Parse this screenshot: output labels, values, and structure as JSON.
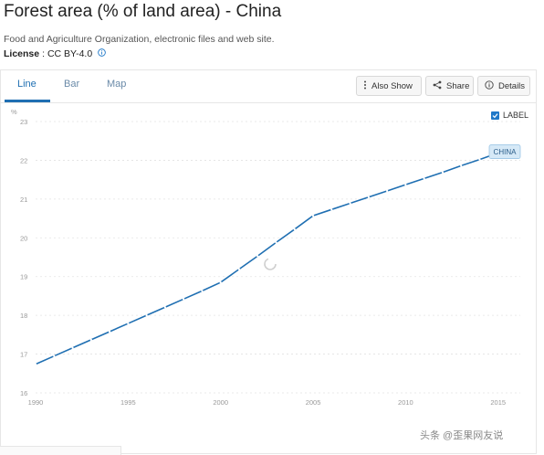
{
  "header": {
    "title": "Forest area (% of land area) - China",
    "source": "Food and Agriculture Organization, electronic files and web site.",
    "license_label": "License",
    "license_value": ": CC BY-4.0"
  },
  "tabs": [
    {
      "label": "Line",
      "active": true
    },
    {
      "label": "Bar",
      "active": false
    },
    {
      "label": "Map",
      "active": false
    }
  ],
  "toolbar": {
    "also_show": "Also Show",
    "share": "Share",
    "details": "Details"
  },
  "label_toggle": {
    "label": "LABEL",
    "checked": true
  },
  "watermark": "头条 @歪果网友说",
  "colors": {
    "line": "#1f6fb2",
    "accent": "#1f78c8",
    "label_bg": "#d6e9f7"
  },
  "chart_data": {
    "type": "line",
    "ylabel": "%",
    "xlim": [
      1990,
      2016
    ],
    "ylim": [
      16,
      23
    ],
    "x_ticks": [
      1990,
      1995,
      2000,
      2005,
      2010,
      2015
    ],
    "y_ticks": [
      16,
      17,
      18,
      19,
      20,
      21,
      22,
      23
    ],
    "grid": true,
    "series": [
      {
        "name": "CHINA",
        "x": [
          1990,
          1991,
          1992,
          1993,
          1994,
          1995,
          1996,
          1997,
          1998,
          1999,
          2000,
          2001,
          2002,
          2003,
          2004,
          2005,
          2006,
          2007,
          2008,
          2009,
          2010,
          2011,
          2012,
          2013,
          2014,
          2015,
          2016
        ],
        "values": [
          16.74,
          16.95,
          17.16,
          17.37,
          17.58,
          17.79,
          18.0,
          18.21,
          18.42,
          18.63,
          18.85,
          19.19,
          19.53,
          19.88,
          20.22,
          20.57,
          20.73,
          20.89,
          21.05,
          21.21,
          21.37,
          21.53,
          21.69,
          21.86,
          22.02,
          22.19,
          22.35
        ]
      }
    ]
  }
}
